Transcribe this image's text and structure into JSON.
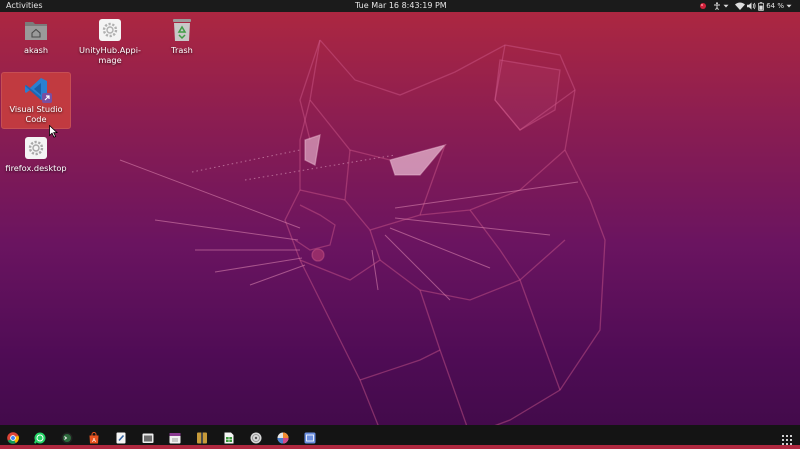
{
  "topbar": {
    "activities_label": "Activities",
    "clock": "Tue Mar 16  8:43:19 PM",
    "battery_percent": "64 %"
  },
  "desktop": {
    "icons": [
      {
        "label": "akash",
        "icon": "home-folder-icon"
      },
      {
        "label": "UnityHub.AppImage",
        "label_line1": "UnityHub.Appi-",
        "label_line2": "mage",
        "icon": "settings-gear-icon"
      },
      {
        "label": "Trash",
        "icon": "trash-icon"
      },
      {
        "label": "Visual Studio Code",
        "label_line1": "Visual Studio",
        "label_line2": "Code",
        "icon": "vscode-icon",
        "selected": true
      },
      {
        "label": "firefox.desktop",
        "icon": "settings-gear-icon"
      }
    ]
  },
  "dock": {
    "apps": [
      "chrome-icon",
      "whatsapp-icon",
      "terminal-icon",
      "software-center-icon",
      "text-editor-icon",
      "files-icon",
      "calendar-icon",
      "archive-icon",
      "spreadsheet-icon",
      "disk-icon",
      "color-picker-icon",
      "screenshot-icon"
    ],
    "show_apps": "app-grid-icon"
  },
  "colors": {
    "topbar": "#1b1b1b",
    "selection": "#c13a40",
    "wallpaper_top": "#b0283f",
    "wallpaper_bottom": "#3f0a48",
    "dock": "#141414"
  }
}
